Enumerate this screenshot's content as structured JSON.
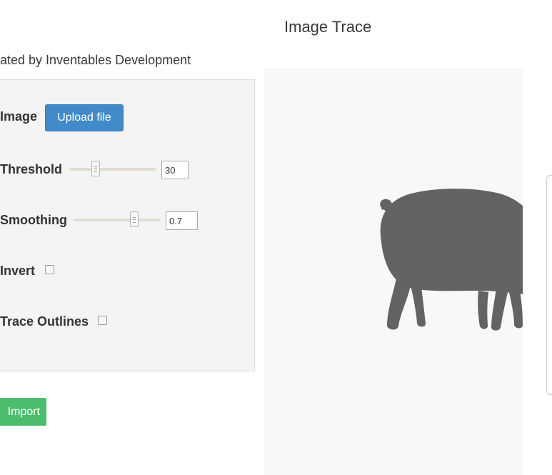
{
  "header": {
    "app_title": "Image Trace",
    "subtitle": "ated by Inventables Development"
  },
  "form": {
    "image_label": "Image",
    "upload_button_label": "Upload file",
    "threshold_label": "Threshold",
    "threshold_value": "30",
    "threshold_slider_fraction": 0.3,
    "smoothing_label": "Smoothing",
    "smoothing_value": "0.7",
    "smoothing_slider_fraction": 0.7,
    "invert_label": "Invert",
    "invert_checked": false,
    "trace_outlines_label": "Trace Outlines",
    "trace_outlines_checked": false
  },
  "actions": {
    "import_label": "Import"
  },
  "preview": {
    "image_subject": "pig-silhouette",
    "fill_color": "#636363"
  },
  "colors": {
    "upload_button": "#428bca",
    "import_button": "#4cbd6c",
    "panel_background": "#f4f4f4"
  }
}
